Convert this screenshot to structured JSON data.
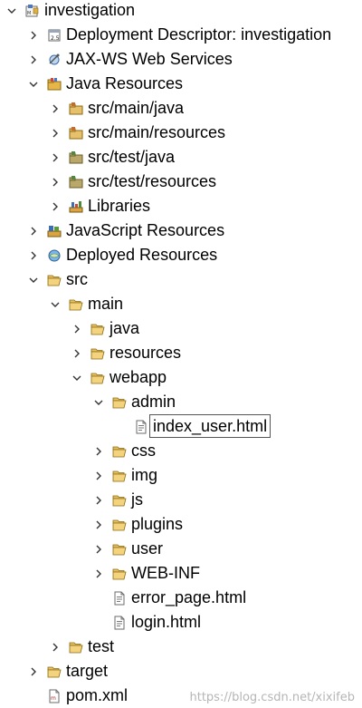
{
  "tree": [
    {
      "name": "node-investigation",
      "label": "investigation",
      "depth": 0,
      "twisty": "expanded",
      "icon": "project-icon"
    },
    {
      "name": "node-deployment-descriptor",
      "label": "Deployment Descriptor: investigation",
      "depth": 1,
      "twisty": "collapsed",
      "icon": "deployment-descriptor-icon"
    },
    {
      "name": "node-jax-ws",
      "label": "JAX-WS Web Services",
      "depth": 1,
      "twisty": "collapsed",
      "icon": "web-services-icon"
    },
    {
      "name": "node-java-resources",
      "label": "Java Resources",
      "depth": 1,
      "twisty": "expanded",
      "icon": "java-resources-icon"
    },
    {
      "name": "node-src-main-java",
      "label": "src/main/java",
      "depth": 2,
      "twisty": "collapsed",
      "icon": "source-folder-icon"
    },
    {
      "name": "node-src-main-resources",
      "label": "src/main/resources",
      "depth": 2,
      "twisty": "collapsed",
      "icon": "source-folder-icon"
    },
    {
      "name": "node-src-test-java",
      "label": "src/test/java",
      "depth": 2,
      "twisty": "collapsed",
      "icon": "test-source-folder-icon"
    },
    {
      "name": "node-src-test-resources",
      "label": "src/test/resources",
      "depth": 2,
      "twisty": "collapsed",
      "icon": "test-source-folder-icon"
    },
    {
      "name": "node-libraries",
      "label": "Libraries",
      "depth": 2,
      "twisty": "collapsed",
      "icon": "libraries-icon"
    },
    {
      "name": "node-javascript-resources",
      "label": "JavaScript Resources",
      "depth": 1,
      "twisty": "collapsed",
      "icon": "javascript-resources-icon"
    },
    {
      "name": "node-deployed-resources",
      "label": "Deployed Resources",
      "depth": 1,
      "twisty": "collapsed",
      "icon": "deployed-resources-icon"
    },
    {
      "name": "node-src",
      "label": "src",
      "depth": 1,
      "twisty": "expanded",
      "icon": "folder-open-icon"
    },
    {
      "name": "node-main",
      "label": "main",
      "depth": 2,
      "twisty": "expanded",
      "icon": "folder-open-icon"
    },
    {
      "name": "node-java",
      "label": "java",
      "depth": 3,
      "twisty": "collapsed",
      "icon": "folder-open-icon"
    },
    {
      "name": "node-resources",
      "label": "resources",
      "depth": 3,
      "twisty": "collapsed",
      "icon": "folder-open-icon"
    },
    {
      "name": "node-webapp",
      "label": "webapp",
      "depth": 3,
      "twisty": "expanded",
      "icon": "folder-open-icon"
    },
    {
      "name": "node-admin",
      "label": "admin",
      "depth": 4,
      "twisty": "expanded",
      "icon": "folder-open-icon"
    },
    {
      "name": "node-index-user-html",
      "label": "index_user.html",
      "depth": 5,
      "twisty": "none",
      "icon": "html-file-icon",
      "selected": true
    },
    {
      "name": "node-css",
      "label": "css",
      "depth": 4,
      "twisty": "collapsed",
      "icon": "folder-open-icon"
    },
    {
      "name": "node-img",
      "label": "img",
      "depth": 4,
      "twisty": "collapsed",
      "icon": "folder-open-icon"
    },
    {
      "name": "node-js",
      "label": "js",
      "depth": 4,
      "twisty": "collapsed",
      "icon": "folder-open-icon"
    },
    {
      "name": "node-plugins",
      "label": "plugins",
      "depth": 4,
      "twisty": "collapsed",
      "icon": "folder-open-icon"
    },
    {
      "name": "node-user",
      "label": "user",
      "depth": 4,
      "twisty": "collapsed",
      "icon": "folder-open-icon"
    },
    {
      "name": "node-web-inf",
      "label": "WEB-INF",
      "depth": 4,
      "twisty": "collapsed",
      "icon": "folder-open-icon"
    },
    {
      "name": "node-error-page-html",
      "label": "error_page.html",
      "depth": 4,
      "twisty": "none",
      "icon": "html-file-icon"
    },
    {
      "name": "node-login-html",
      "label": "login.html",
      "depth": 4,
      "twisty": "none",
      "icon": "html-file-icon"
    },
    {
      "name": "node-test",
      "label": "test",
      "depth": 2,
      "twisty": "collapsed",
      "icon": "folder-open-icon"
    },
    {
      "name": "node-target",
      "label": "target",
      "depth": 1,
      "twisty": "collapsed",
      "icon": "folder-open-icon"
    },
    {
      "name": "node-pom-xml",
      "label": "pom.xml",
      "depth": 1,
      "twisty": "none",
      "icon": "xml-file-icon"
    }
  ],
  "watermark": "https://blog.csdn.net/xixifeb"
}
